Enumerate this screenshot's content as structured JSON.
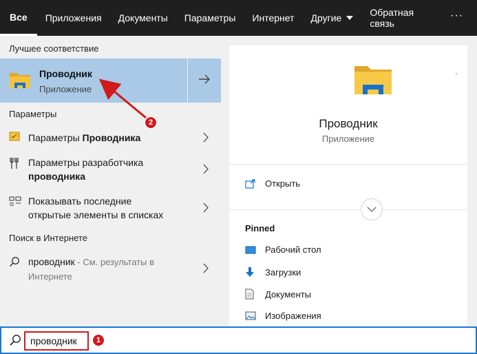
{
  "tabs": [
    {
      "label": "Все"
    },
    {
      "label": "Приложения"
    },
    {
      "label": "Документы"
    },
    {
      "label": "Параметры"
    },
    {
      "label": "Интернет"
    },
    {
      "label": "Другие"
    },
    {
      "label": "Обратная связь"
    },
    {
      "label": "···"
    }
  ],
  "left": {
    "best_match_heading": "Лучшее соответствие",
    "best_match": {
      "title": "Проводник",
      "subtitle": "Приложение"
    },
    "settings_heading": "Параметры",
    "settings": [
      {
        "prefix": "Параметры ",
        "bold": "Проводника",
        "line2": ""
      },
      {
        "prefix": "Параметры разработчика",
        "bold": "проводника",
        "line2": ""
      },
      {
        "prefix": "Показывать последние",
        "bold": "",
        "line2": "открытые элементы в списках"
      }
    ],
    "web_heading": "Поиск в Интернете",
    "web": {
      "query": "проводник",
      "hint": " - См. результаты в",
      "line2": "Интернете"
    }
  },
  "preview": {
    "title": "Проводник",
    "subtitle": "Приложение",
    "open_label": "Открыть",
    "pinned_heading": "Pinned",
    "pinned": [
      {
        "label": "Рабочий стол"
      },
      {
        "label": "Загрузки"
      },
      {
        "label": "Документы"
      },
      {
        "label": "Изображения"
      }
    ]
  },
  "search": {
    "value": "проводник"
  },
  "annotations": {
    "marker1": "1",
    "marker2": "2",
    "color": "#d11a1a"
  },
  "colors": {
    "accent": "#1479d6",
    "selection": "#a9c9e7",
    "folder": "#f5c33b",
    "topbar": "#1f1f1f"
  }
}
